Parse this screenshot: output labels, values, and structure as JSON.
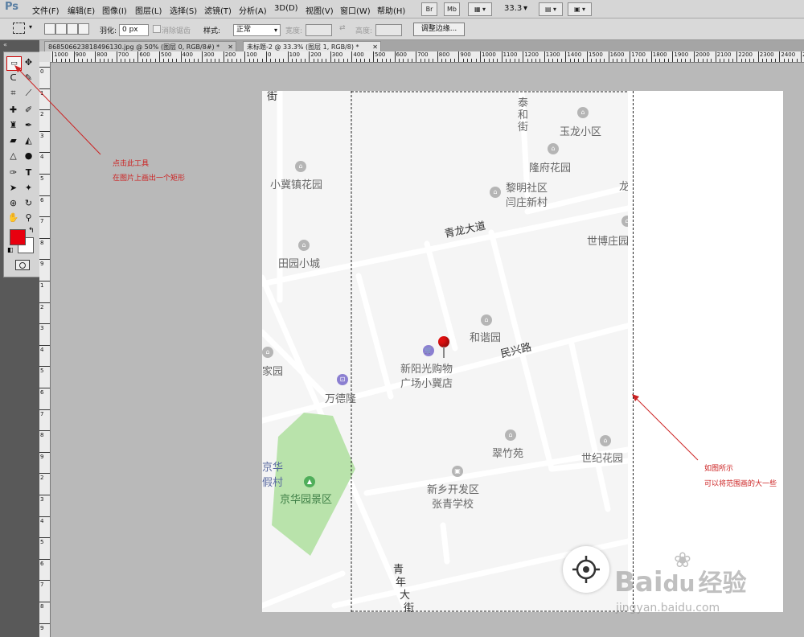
{
  "app": {
    "logo": "Ps"
  },
  "menubar": {
    "items": [
      "文件(F)",
      "编辑(E)",
      "图像(I)",
      "图层(L)",
      "选择(S)",
      "滤镜(T)",
      "分析(A)",
      "3D(D)",
      "视图(V)",
      "窗口(W)",
      "帮助(H)"
    ],
    "bridge": "Br",
    "minibridge": "Mb",
    "zoom": "33.3"
  },
  "options": {
    "feather_label": "羽化:",
    "feather_value": "0 px",
    "antialias_label": "消除锯齿",
    "style_label": "样式:",
    "style_value": "正常",
    "width_label": "宽度:",
    "height_label": "高度:",
    "refine_button": "调整边缘..."
  },
  "tabs": [
    {
      "title": "868506623818496130.jpg @ 50% (图层 0, RGB/8#) *",
      "active": false
    },
    {
      "title": "未标题-2 @ 33.3% (图层 1, RGB/8) *",
      "active": true
    }
  ],
  "ruler": {
    "labels": [
      "1000",
      "900",
      "800",
      "700",
      "600",
      "500",
      "400",
      "300",
      "200",
      "100",
      "0",
      "100",
      "200",
      "300",
      "400",
      "500",
      "600",
      "700",
      "800",
      "900",
      "1000",
      "1100",
      "1200",
      "1300",
      "1400",
      "1500",
      "1600",
      "1700",
      "1800",
      "1900",
      "2000",
      "2100",
      "2200",
      "2300",
      "2400",
      "25"
    ],
    "vlabels": [
      "0",
      "1",
      "2",
      "3",
      "4",
      "5",
      "6",
      "7",
      "8",
      "9",
      "1",
      "2",
      "3",
      "4",
      "5",
      "6",
      "7",
      "8",
      "9",
      "2",
      "3",
      "4",
      "5",
      "6",
      "7",
      "8",
      "9"
    ]
  },
  "annotations": {
    "note1_line1": "点击此工具",
    "note1_line2": "在图片上画出一个矩形",
    "note2_line1": "如图所示",
    "note2_line2": "可以将范围画的大一些"
  },
  "map": {
    "places": [
      "泰",
      "和",
      "街",
      "玉龙小区",
      "隆府花园",
      "小冀镇花园",
      "黎明社区",
      "闫庄新村",
      "龙",
      "世博庄园",
      "田园小城",
      "和谐园",
      "新阳光购物",
      "广场小冀店",
      "万德隆",
      "家园",
      "翠竹苑",
      "世纪花园",
      "京华",
      "假村",
      "京华园景区",
      "新乡开发区",
      "张青学校",
      "街"
    ],
    "roads": [
      "青龙大道",
      "民兴路",
      "青",
      "年",
      "大",
      "街"
    ]
  },
  "watermark": {
    "brand": "Bai",
    "brand2": "du",
    "suffix": "经验",
    "url": "jingyan.baidu.com"
  },
  "colors": {
    "foreground": "#e8000f",
    "background": "#ffffff",
    "annotation": "#cc2222",
    "park": "#b9e3ab",
    "pin": "#e01010"
  }
}
